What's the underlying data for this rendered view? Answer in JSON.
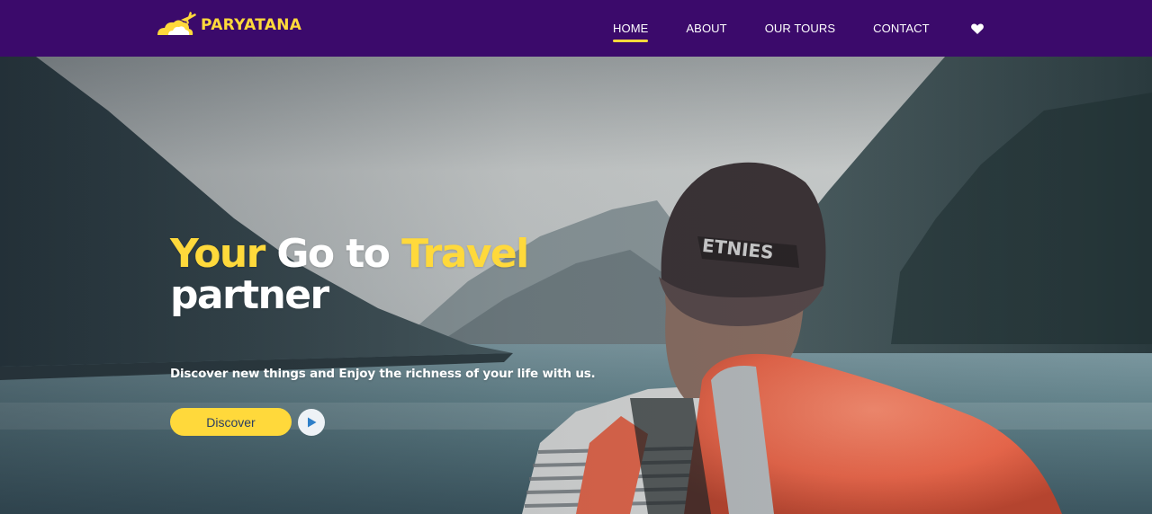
{
  "brand": {
    "name": "PARYATANA",
    "logo_icon": "airplane-cloud-logo-icon"
  },
  "nav": {
    "items": [
      {
        "label": "HOME",
        "active": true
      },
      {
        "label": "ABOUT",
        "active": false
      },
      {
        "label": "OUR TOURS",
        "active": false
      },
      {
        "label": "CONTACT",
        "active": false
      }
    ],
    "favorites_icon": "heart-icon"
  },
  "hero": {
    "title": {
      "part1": "Your",
      "part2": "Go to",
      "part3": "Travel",
      "part4": "partner"
    },
    "subtitle": "Discover new things and Enjoy the richness of your life with us.",
    "cta_label": "Discover",
    "play_icon": "play-icon",
    "background": "traveler-with-backpack-at-mountain-lake"
  },
  "colors": {
    "navbar_bg": "#3b0a6b",
    "accent_yellow": "#ffd93b",
    "button_text": "#2a3d63",
    "play_icon": "#2f7fc8"
  }
}
